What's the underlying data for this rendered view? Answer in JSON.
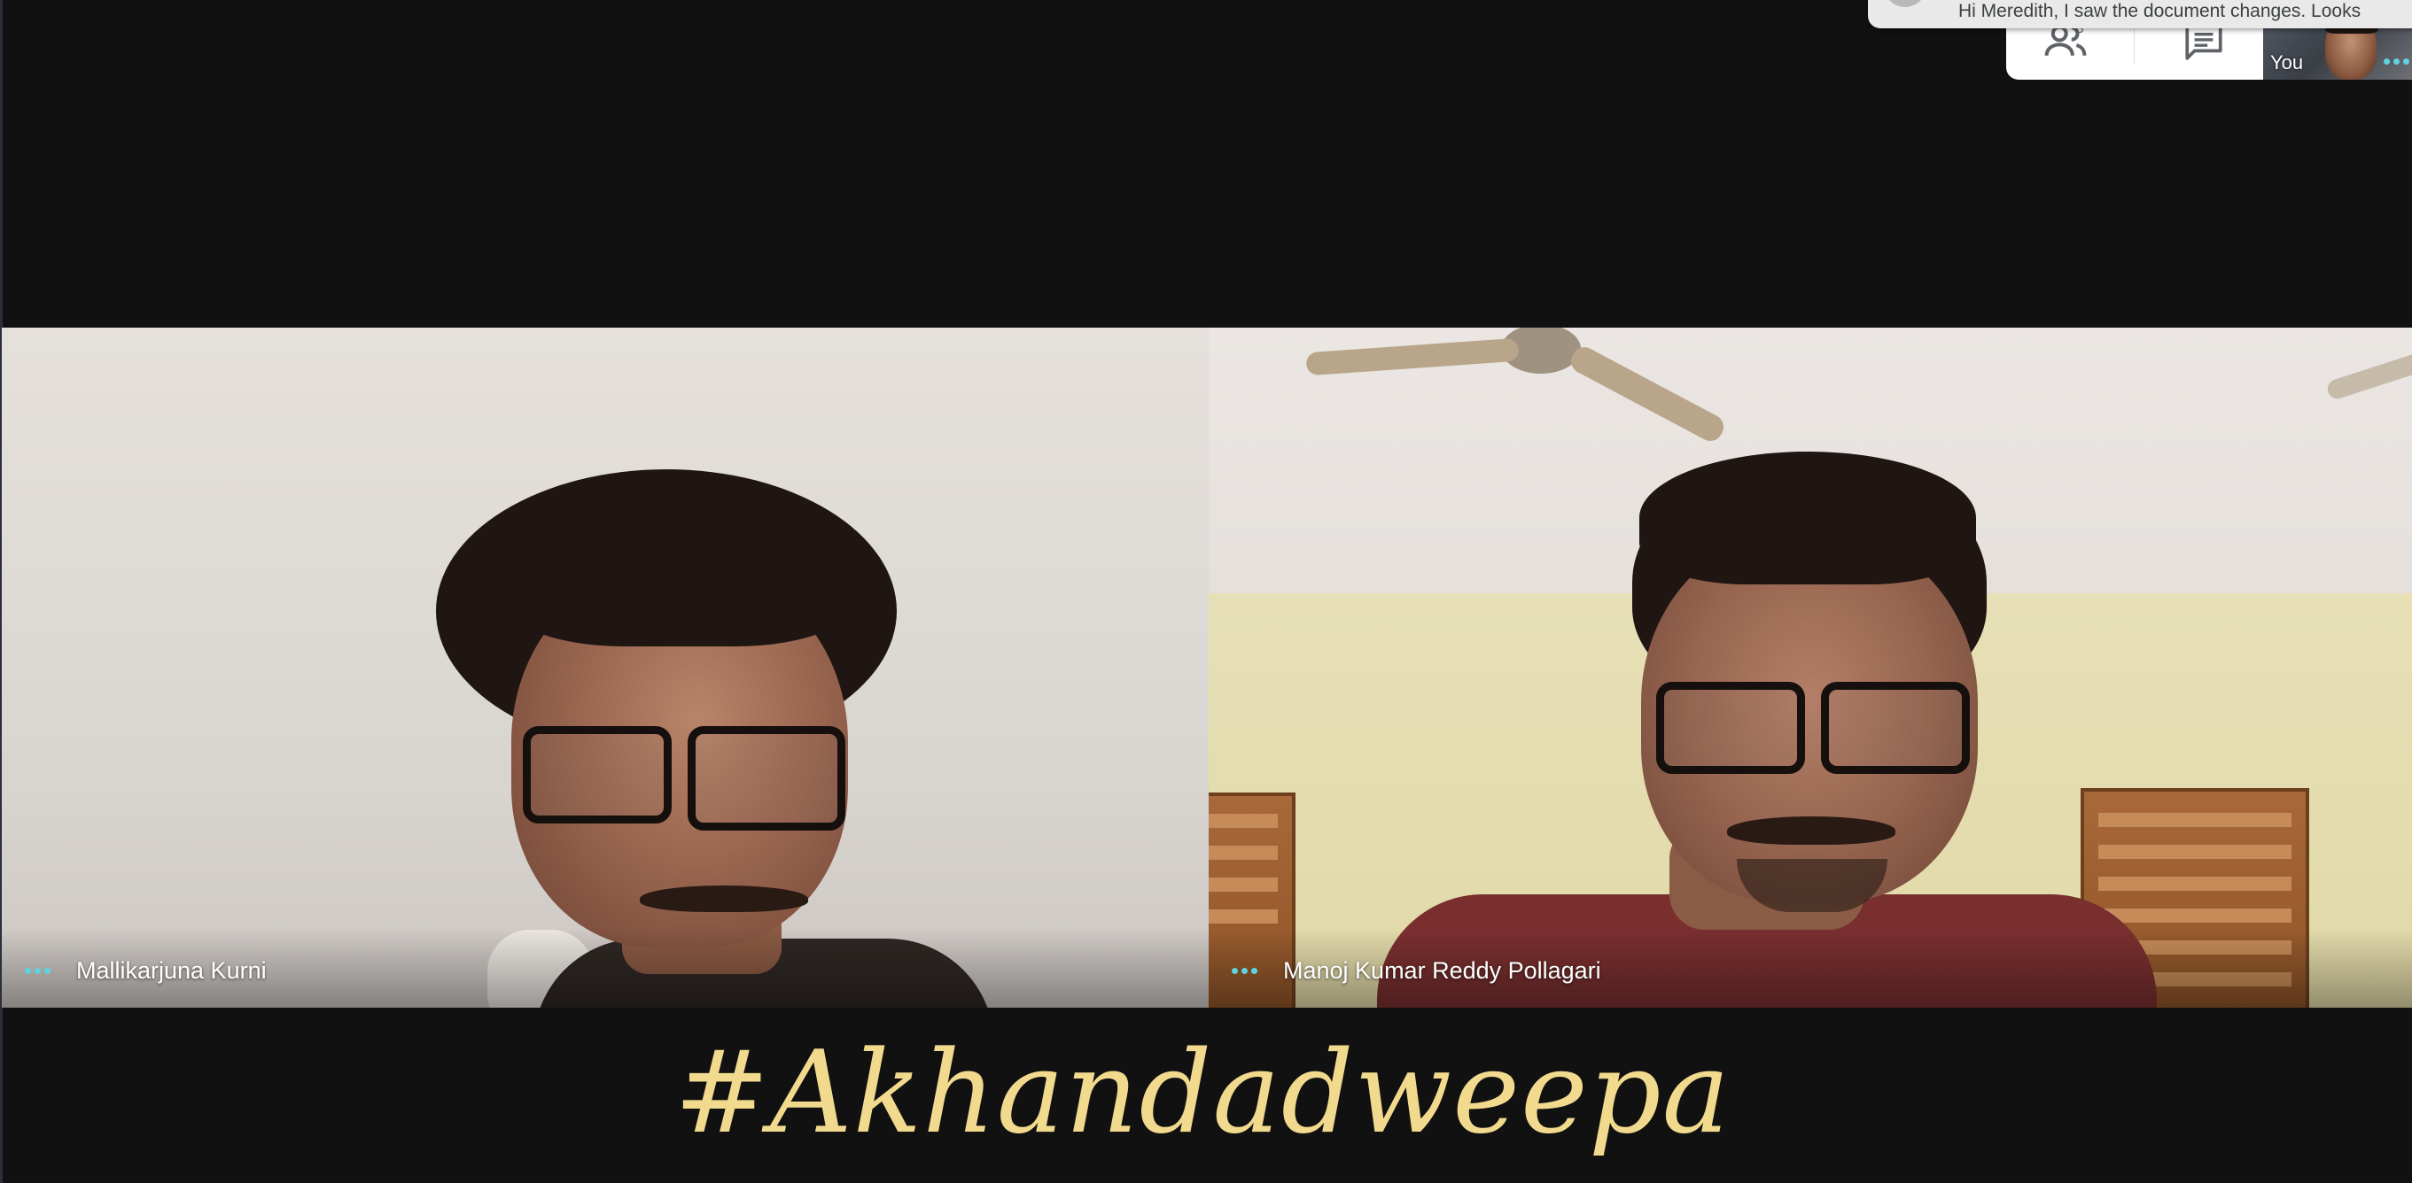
{
  "chat_toast": {
    "message": "Hi Meredith, I saw the document changes. Looks"
  },
  "controls": {
    "people_icon": "people-icon",
    "chat_icon": "chat-icon"
  },
  "self_view": {
    "label": "You"
  },
  "participants": [
    {
      "name": "Mallikarjuna Kurni"
    },
    {
      "name": "Manoj Kumar Reddy Pollagari"
    }
  ],
  "overlay_text": "#Akhandadweepa",
  "colors": {
    "background": "#111111",
    "accent_dots": "#5fd3e0",
    "hashtag": "#f1da8d"
  }
}
